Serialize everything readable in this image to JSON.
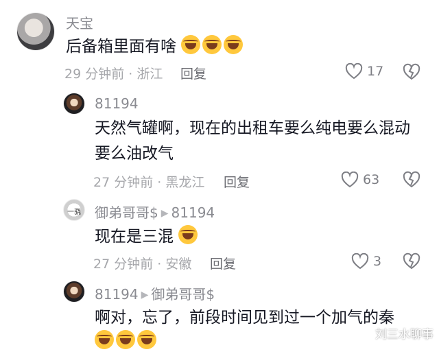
{
  "comments": [
    {
      "user": "天宝",
      "text": "后备箱里面有啥",
      "emoji_count": 3,
      "time_location": "29 分钟前 · 浙江",
      "reply_label": "回复",
      "likes": "17"
    },
    {
      "user": "81194",
      "text_line1": "天然气罐啊，现在的出租车要么纯电要么混动",
      "text_line2": "要么油改气",
      "time_location": "27 分钟前 · 黑龙江",
      "reply_label": "回复",
      "likes": "63"
    },
    {
      "user": "御弟哥哥$",
      "reply_to": "81194",
      "text": "现在是三混",
      "emoji_count": 1,
      "time_location": "27 分钟前 · 安徽",
      "reply_label": "回复",
      "likes": "3"
    },
    {
      "user": "81194",
      "reply_to": "御弟哥哥$",
      "text": "啊对，忘了，前段时间见到过一个加气的秦",
      "emoji_count": 3
    }
  ],
  "watermark": "刘三水聊事",
  "icons": {
    "like": "heart-outline-icon",
    "dislike": "broken-heart-icon",
    "emoji": "laugh-crying-emoji"
  },
  "colors": {
    "text": "#161823",
    "meta": "#a6a7ab",
    "emoji": "#ffc83d"
  }
}
